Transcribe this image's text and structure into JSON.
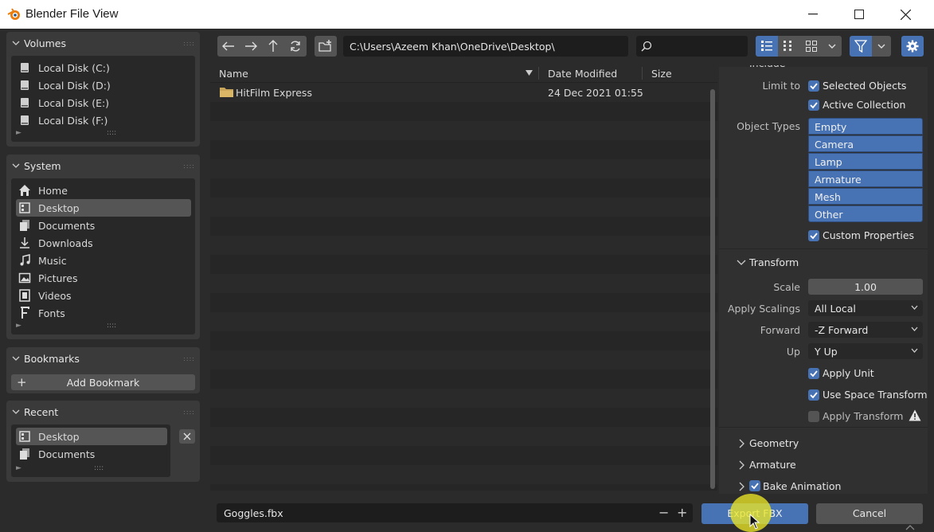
{
  "window": {
    "title": "Blender File View",
    "controls": [
      "minimize",
      "maximize",
      "close"
    ]
  },
  "sidebar": {
    "volumes": {
      "title": "Volumes",
      "items": [
        {
          "label": "Local Disk (C:)",
          "icon": "drive-icon"
        },
        {
          "label": "Local Disk (D:)",
          "icon": "drive-icon"
        },
        {
          "label": "Local Disk (E:)",
          "icon": "drive-icon"
        },
        {
          "label": "Local Disk (F:)",
          "icon": "drive-icon"
        }
      ]
    },
    "system": {
      "title": "System",
      "items": [
        {
          "label": "Home",
          "icon": "home-icon"
        },
        {
          "label": "Desktop",
          "icon": "desktop-icon",
          "active": true
        },
        {
          "label": "Documents",
          "icon": "documents-icon"
        },
        {
          "label": "Downloads",
          "icon": "download-icon"
        },
        {
          "label": "Music",
          "icon": "music-icon"
        },
        {
          "label": "Pictures",
          "icon": "image-icon"
        },
        {
          "label": "Videos",
          "icon": "video-icon"
        },
        {
          "label": "Fonts",
          "icon": "font-icon"
        }
      ]
    },
    "bookmarks": {
      "title": "Bookmarks",
      "add_label": "Add Bookmark"
    },
    "recent": {
      "title": "Recent",
      "items": [
        {
          "label": "Desktop",
          "icon": "desktop-icon",
          "active": true
        },
        {
          "label": "Documents",
          "icon": "documents-icon"
        }
      ]
    }
  },
  "toolbar": {
    "path": "C:\\Users\\Azeem Khan\\OneDrive\\Desktop\\",
    "search_placeholder": ""
  },
  "file_list": {
    "columns": [
      "Name",
      "Date Modified",
      "Size"
    ],
    "rows": [
      {
        "name": "HitFilm Express",
        "date": "24 Dec 2021 01:55",
        "size": "",
        "icon": "folder-icon"
      }
    ]
  },
  "options": {
    "include_label": "Include",
    "limit_to_label": "Limit to",
    "selected_objects": {
      "label": "Selected Objects",
      "checked": true
    },
    "active_collection": {
      "label": "Active Collection",
      "checked": true
    },
    "object_types_label": "Object Types",
    "object_types": [
      "Empty",
      "Camera",
      "Lamp",
      "Armature",
      "Mesh",
      "Other"
    ],
    "custom_properties": {
      "label": "Custom Properties",
      "checked": true
    },
    "transform": {
      "title": "Transform",
      "scale_label": "Scale",
      "scale_value": "1.00",
      "apply_scalings_label": "Apply Scalings",
      "apply_scalings_value": "All Local",
      "forward_label": "Forward",
      "forward_value": "-Z Forward",
      "up_label": "Up",
      "up_value": "Y Up",
      "apply_unit": {
        "label": "Apply Unit",
        "checked": true
      },
      "use_space_transform": {
        "label": "Use Space Transform",
        "checked": true
      },
      "apply_transform": {
        "label": "Apply Transform",
        "checked": false
      }
    },
    "geometry_label": "Geometry",
    "armature_label": "Armature",
    "bake_animation": {
      "label": "Bake Animation",
      "checked": true
    }
  },
  "bottom": {
    "filename": "Goggles.fbx",
    "export_label": "Export FBX",
    "cancel_label": "Cancel"
  },
  "colors": {
    "accent": "#4772b3",
    "background": "#2b2b2b",
    "button": "#545454",
    "cursor_highlight": "#ebe628"
  }
}
